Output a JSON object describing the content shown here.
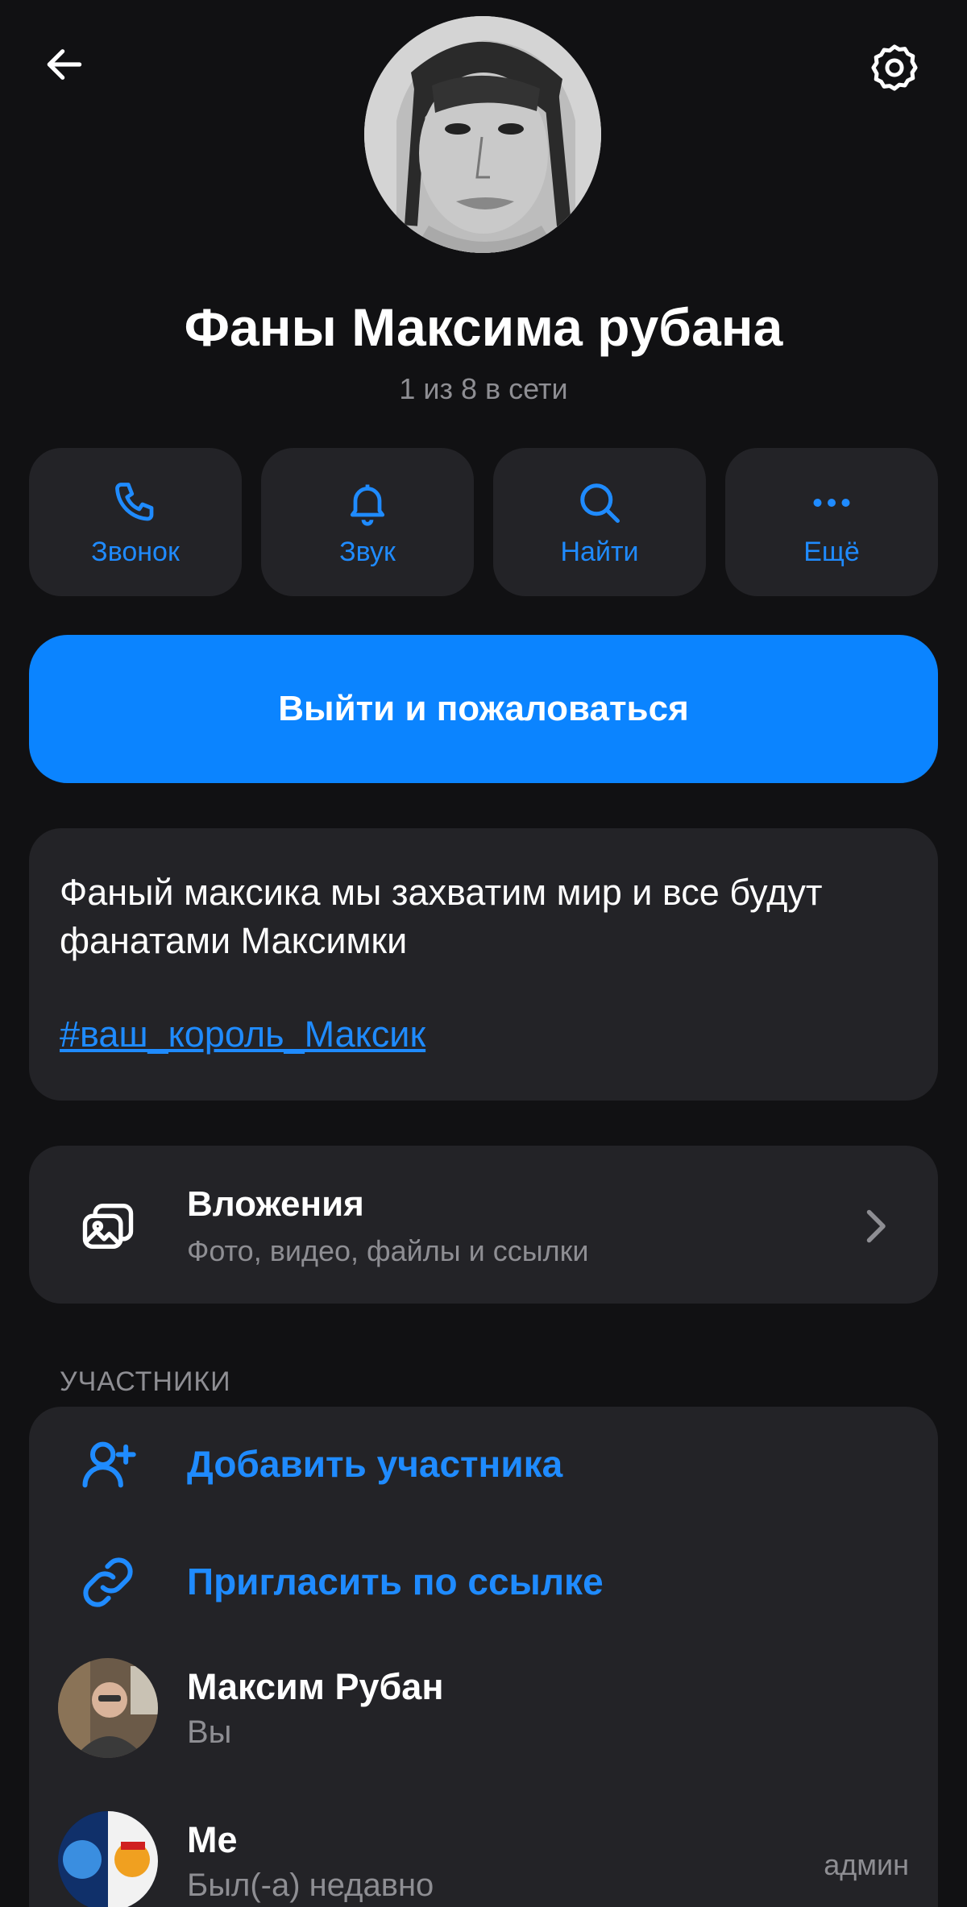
{
  "header": {
    "back_icon": "arrow-left-icon",
    "settings_icon": "gear-icon",
    "title": "Фаны Максима рубана",
    "subtitle": "1 из 8 в сети"
  },
  "actions": [
    {
      "label": "Звонок",
      "icon": "phone-icon"
    },
    {
      "label": "Звук",
      "icon": "bell-icon"
    },
    {
      "label": "Найти",
      "icon": "search-icon"
    },
    {
      "label": "Ещё",
      "icon": "more-dots-icon"
    }
  ],
  "cta": {
    "label": "Выйти и пожаловаться"
  },
  "description": {
    "text": "Фаный максика мы захватим мир и все будут фанатами Максимки",
    "hashtag": "#ваш_король_Максик"
  },
  "attachments": {
    "title": "Вложения",
    "subtitle": "Фото, видео, файлы и ссылки",
    "icon": "gallery-icon"
  },
  "members": {
    "section_label": "УЧАСТНИКИ",
    "add_label": "Добавить участника",
    "invite_label": "Пригласить по ссылке",
    "list": [
      {
        "name": "Максим Рубан",
        "status": "Вы",
        "role": ""
      },
      {
        "name": "Me",
        "status": "Был(-а) недавно",
        "role": "админ"
      }
    ]
  },
  "colors": {
    "background": "#111113",
    "card": "#232327",
    "accent": "#0b84ff",
    "link": "#1f8bff",
    "secondary_text": "#8e8e93"
  }
}
